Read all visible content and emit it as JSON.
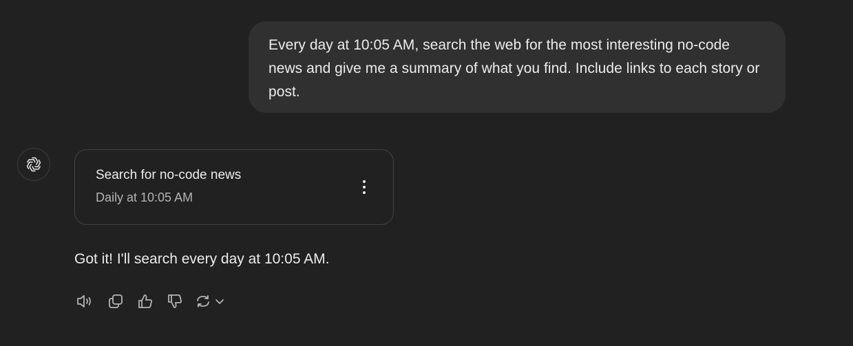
{
  "user_message": {
    "text": "Every day at 10:05 AM, search the web for the most interesting no-code news and give me a summary of what you find. Include links to each story or post."
  },
  "assistant": {
    "avatar_icon": "openai-logo-icon",
    "task_card": {
      "title": "Search for no-code news",
      "schedule": "Daily at 10:05 AM",
      "menu_icon": "more-vertical-icon"
    },
    "reply_text": "Got it! I'll search every day at 10:05 AM.",
    "actions": [
      {
        "name": "read-aloud",
        "icon": "speaker-icon"
      },
      {
        "name": "copy",
        "icon": "copy-icon"
      },
      {
        "name": "good-response",
        "icon": "thumbs-up-icon"
      },
      {
        "name": "bad-response",
        "icon": "thumbs-down-icon"
      },
      {
        "name": "regenerate",
        "icon": "refresh-icon"
      },
      {
        "name": "switch-model",
        "icon": "chevron-down-icon"
      }
    ]
  },
  "colors": {
    "background": "#212121",
    "user_bubble": "#303030",
    "text_primary": "#ececec",
    "text_secondary": "#b4b4b4",
    "icon": "#b4b4b4"
  }
}
